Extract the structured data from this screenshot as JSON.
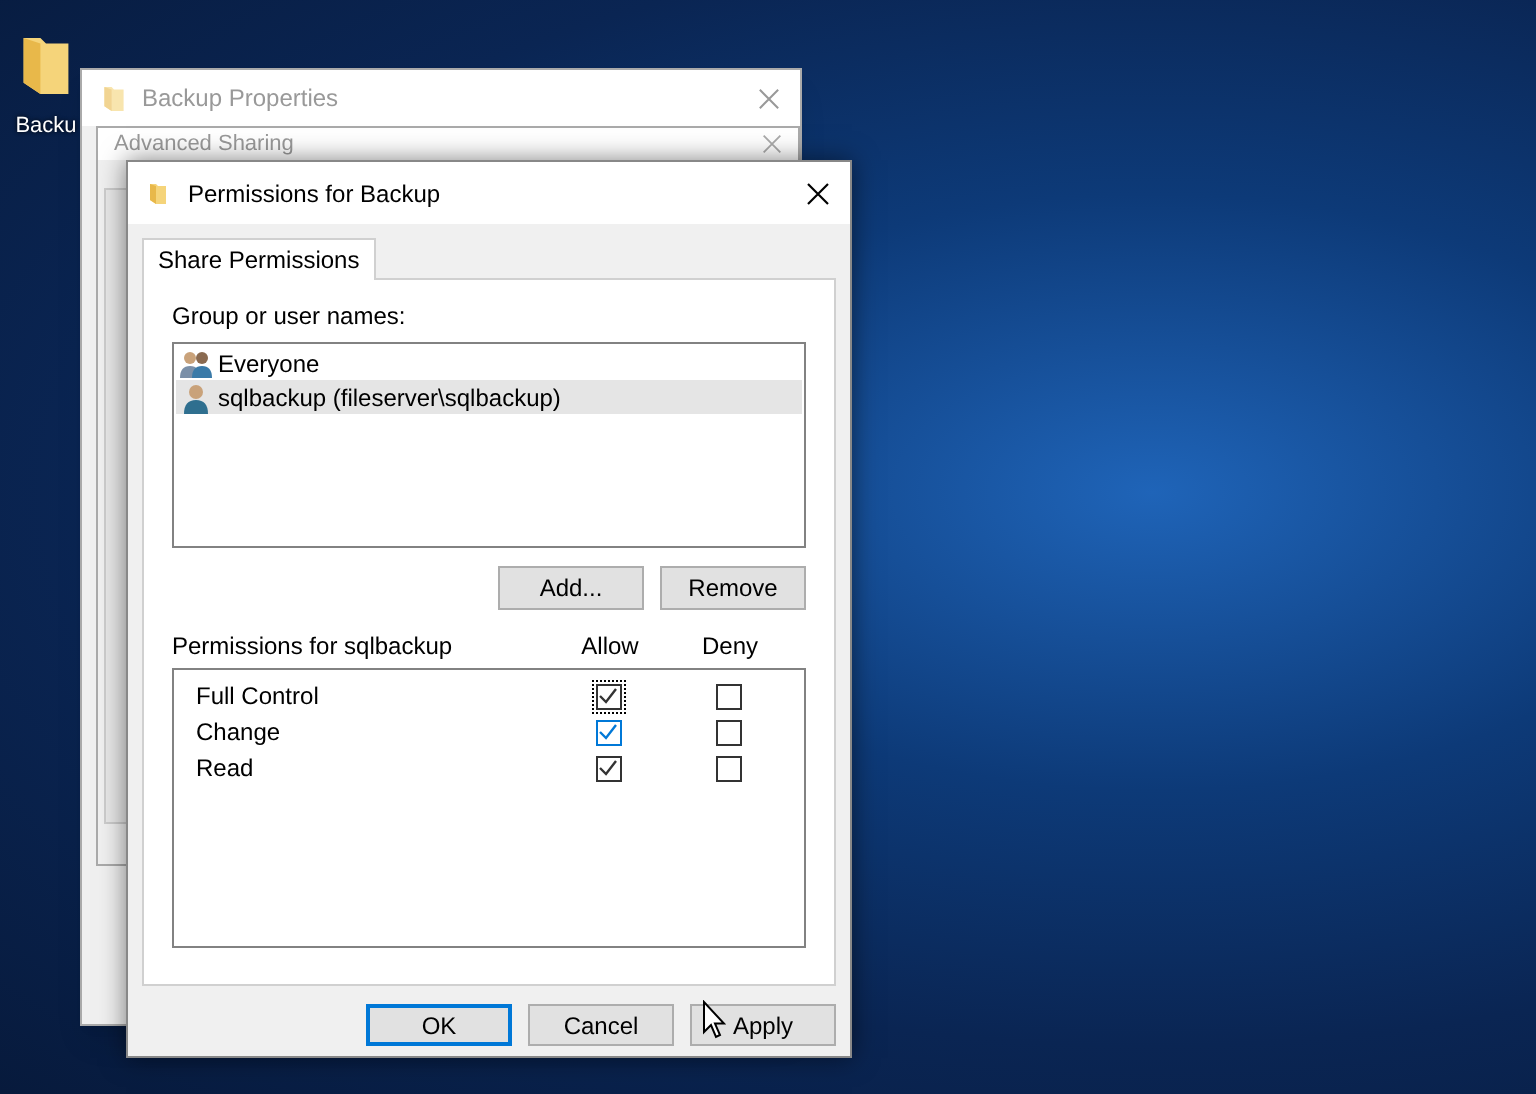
{
  "desktop": {
    "icon_label": "Backu"
  },
  "back_window": {
    "title": "Backup Properties"
  },
  "middle_window": {
    "title": "Advanced Sharing"
  },
  "dialog": {
    "title": "Permissions for Backup",
    "tabs": [
      {
        "label": "Share Permissions",
        "selected": true
      }
    ],
    "users_label": "Group or user names:",
    "users": [
      {
        "kind": "group",
        "name": "Everyone",
        "selected": false
      },
      {
        "kind": "user",
        "name": "sqlbackup (fileserver\\sqlbackup)",
        "selected": true
      }
    ],
    "user_buttons": [
      "Add...",
      "Remove"
    ],
    "permissions_label": "Permissions for sqlbackup",
    "columns": [
      "Allow",
      "Deny"
    ],
    "permissions": [
      {
        "name": "Full Control",
        "allow": {
          "checked": true,
          "focused": true,
          "hot": false
        },
        "deny": {
          "checked": false,
          "focused": false,
          "hot": false
        }
      },
      {
        "name": "Change",
        "allow": {
          "checked": true,
          "focused": false,
          "hot": true
        },
        "deny": {
          "checked": false,
          "focused": false,
          "hot": false
        }
      },
      {
        "name": "Read",
        "allow": {
          "checked": true,
          "focused": false,
          "hot": false
        },
        "deny": {
          "checked": false,
          "focused": false,
          "hot": false
        }
      }
    ],
    "buttons": [
      {
        "label": "OK",
        "default": true
      },
      {
        "label": "Cancel",
        "default": false
      },
      {
        "label": "Apply",
        "default": false
      }
    ]
  }
}
